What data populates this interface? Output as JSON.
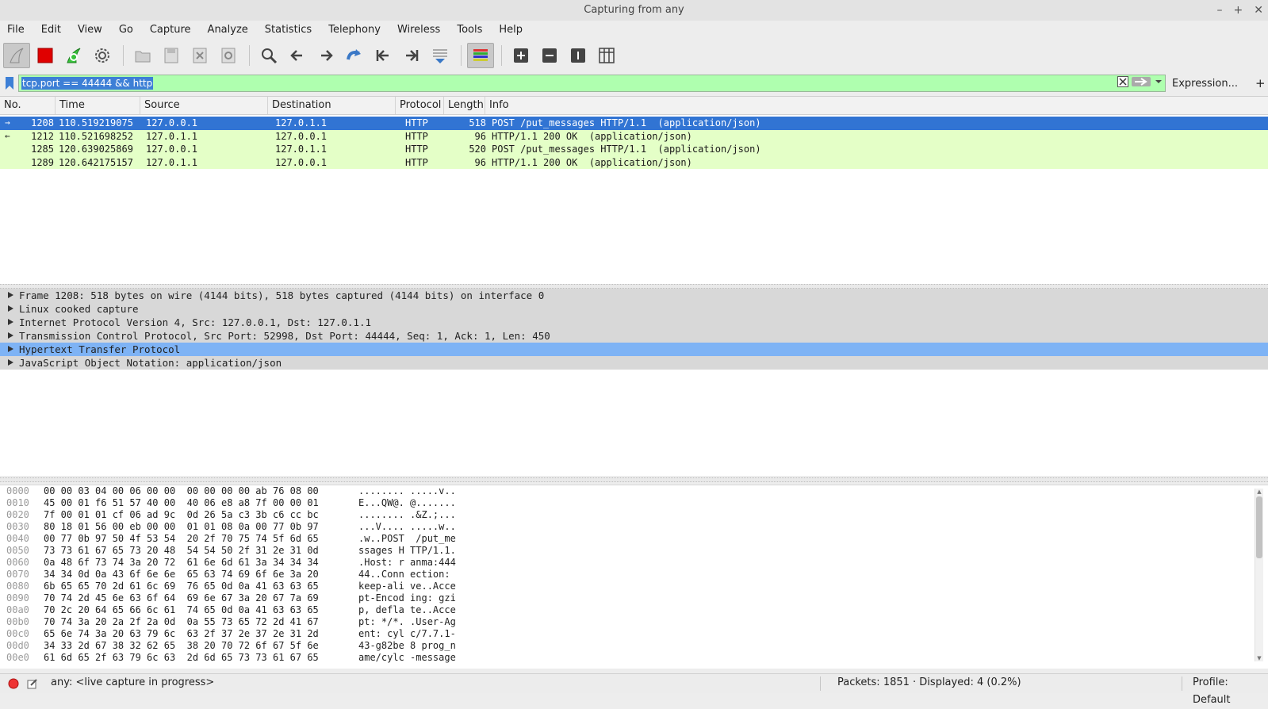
{
  "window": {
    "title": "Capturing from any",
    "controls": [
      "–",
      "+",
      "✕"
    ]
  },
  "menu": [
    "File",
    "Edit",
    "View",
    "Go",
    "Capture",
    "Analyze",
    "Statistics",
    "Telephony",
    "Wireless",
    "Tools",
    "Help"
  ],
  "filter": {
    "value": "tcp.port == 44444  && http",
    "expression_label": "Expression...",
    "add_label": "+"
  },
  "packet_list": {
    "columns": [
      "No.",
      "Time",
      "Source",
      "Destination",
      "Protocol",
      "Length",
      "Info"
    ],
    "rows": [
      {
        "no": "1208",
        "time": "110.519219075",
        "src": "127.0.0.1",
        "dst": "127.0.1.1",
        "proto": "HTTP",
        "len": "518",
        "info": "POST /put_messages HTTP/1.1  (application/json)",
        "selected": true,
        "mark": "→"
      },
      {
        "no": "1212",
        "time": "110.521698252",
        "src": "127.0.1.1",
        "dst": "127.0.0.1",
        "proto": "HTTP",
        "len": "96",
        "info": "HTTP/1.1 200 OK  (application/json)",
        "selected": false,
        "mark": "←"
      },
      {
        "no": "1285",
        "time": "120.639025869",
        "src": "127.0.0.1",
        "dst": "127.0.1.1",
        "proto": "HTTP",
        "len": "520",
        "info": "POST /put_messages HTTP/1.1  (application/json)",
        "selected": false,
        "mark": ""
      },
      {
        "no": "1289",
        "time": "120.642175157",
        "src": "127.0.1.1",
        "dst": "127.0.0.1",
        "proto": "HTTP",
        "len": "96",
        "info": "HTTP/1.1 200 OK  (application/json)",
        "selected": false,
        "mark": ""
      }
    ]
  },
  "details": [
    {
      "text": "Frame 1208: 518 bytes on wire (4144 bits), 518 bytes captured (4144 bits) on interface 0",
      "selected": false
    },
    {
      "text": "Linux cooked capture",
      "selected": false
    },
    {
      "text": "Internet Protocol Version 4, Src: 127.0.0.1, Dst: 127.0.1.1",
      "selected": false
    },
    {
      "text": "Transmission Control Protocol, Src Port: 52998, Dst Port: 44444, Seq: 1, Ack: 1, Len: 450",
      "selected": false
    },
    {
      "text": "Hypertext Transfer Protocol",
      "selected": true
    },
    {
      "text": "JavaScript Object Notation: application/json",
      "selected": false
    }
  ],
  "bytes": [
    {
      "off": "0000",
      "hex": "00 00 03 04 00 06 00 00  00 00 00 00 ab 76 08 00",
      "ascii": "........ .....v.."
    },
    {
      "off": "0010",
      "hex": "45 00 01 f6 51 57 40 00  40 06 e8 a8 7f 00 00 01",
      "ascii": "E...QW@. @......."
    },
    {
      "off": "0020",
      "hex": "7f 00 01 01 cf 06 ad 9c  0d 26 5a c3 3b c6 cc bc",
      "ascii": "........ .&Z.;..."
    },
    {
      "off": "0030",
      "hex": "80 18 01 56 00 eb 00 00  01 01 08 0a 00 77 0b 97",
      "ascii": "...V.... .....w.."
    },
    {
      "off": "0040",
      "hex": "00 77 0b 97 50 4f 53 54  20 2f 70 75 74 5f 6d 65",
      "ascii": ".w..POST  /put_me"
    },
    {
      "off": "0050",
      "hex": "73 73 61 67 65 73 20 48  54 54 50 2f 31 2e 31 0d",
      "ascii": "ssages H TTP/1.1."
    },
    {
      "off": "0060",
      "hex": "0a 48 6f 73 74 3a 20 72  61 6e 6d 61 3a 34 34 34",
      "ascii": ".Host: r anma:444"
    },
    {
      "off": "0070",
      "hex": "34 34 0d 0a 43 6f 6e 6e  65 63 74 69 6f 6e 3a 20",
      "ascii": "44..Conn ection: "
    },
    {
      "off": "0080",
      "hex": "6b 65 65 70 2d 61 6c 69  76 65 0d 0a 41 63 63 65",
      "ascii": "keep-ali ve..Acce"
    },
    {
      "off": "0090",
      "hex": "70 74 2d 45 6e 63 6f 64  69 6e 67 3a 20 67 7a 69",
      "ascii": "pt-Encod ing: gzi"
    },
    {
      "off": "00a0",
      "hex": "70 2c 20 64 65 66 6c 61  74 65 0d 0a 41 63 63 65",
      "ascii": "p, defla te..Acce"
    },
    {
      "off": "00b0",
      "hex": "70 74 3a 20 2a 2f 2a 0d  0a 55 73 65 72 2d 41 67",
      "ascii": "pt: */*. .User-Ag"
    },
    {
      "off": "00c0",
      "hex": "65 6e 74 3a 20 63 79 6c  63 2f 37 2e 37 2e 31 2d",
      "ascii": "ent: cyl c/7.7.1-"
    },
    {
      "off": "00d0",
      "hex": "34 33 2d 67 38 32 62 65  38 20 70 72 6f 67 5f 6e",
      "ascii": "43-g82be 8 prog_n"
    },
    {
      "off": "00e0",
      "hex": "61 6d 65 2f 63 79 6c 63  2d 6d 65 73 73 61 67 65",
      "ascii": "ame/cylc -message"
    }
  ],
  "status": {
    "capture_text": "any: <live capture in progress>",
    "packets_text": "Packets: 1851 · Displayed: 4 (0.2%)",
    "profile_text": "Profile: Default"
  },
  "colors": {
    "http_row": "#e4ffc7",
    "selected_row": "#3174d3",
    "filter_valid": "#afffaf",
    "selected_detail": "#7eb3f5"
  }
}
